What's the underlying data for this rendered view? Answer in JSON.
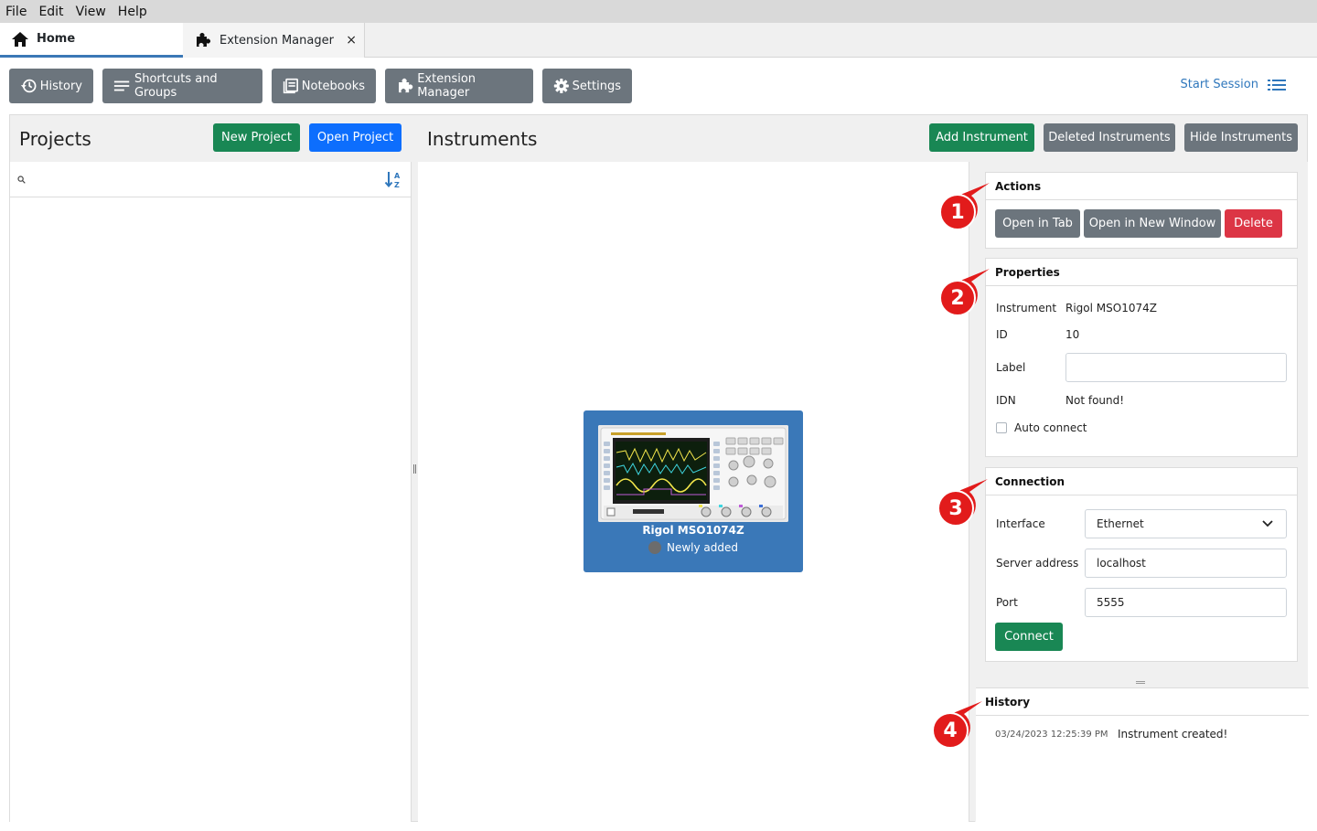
{
  "menu": [
    "File",
    "Edit",
    "View",
    "Help"
  ],
  "tabs": [
    {
      "label": "Home",
      "active": true
    },
    {
      "label": "Extension Manager",
      "closable": true,
      "close_glyph": "×"
    }
  ],
  "toolbar": {
    "buttons": [
      "History",
      "Shortcuts and Groups",
      "Notebooks",
      "Extension Manager",
      "Settings"
    ],
    "start_session": "Start Session"
  },
  "projects": {
    "title": "Projects",
    "new_project": "New Project",
    "open_project": "Open Project",
    "search_placeholder": ""
  },
  "instruments": {
    "title": "Instruments",
    "add_instrument": "Add Instrument",
    "deleted_instruments": "Deleted Instruments",
    "hide_instruments": "Hide Instruments",
    "card": {
      "name": "Rigol MSO1074Z",
      "status": "Newly added"
    }
  },
  "actions": {
    "title": "Actions",
    "open_in_tab": "Open in Tab",
    "open_in_new_window": "Open in New Window",
    "delete": "Delete"
  },
  "properties": {
    "title": "Properties",
    "instrument_label": "Instrument",
    "instrument_value": "Rigol MSO1074Z",
    "id_label": "ID",
    "id_value": "10",
    "label_label": "Label",
    "label_value": "",
    "idn_label": "IDN",
    "idn_value": "Not found!",
    "auto_connect": "Auto connect",
    "auto_connect_checked": false
  },
  "connection": {
    "title": "Connection",
    "interface_label": "Interface",
    "interface_value": "Ethernet",
    "server_label": "Server address",
    "server_value": "localhost",
    "port_label": "Port",
    "port_value": "5555",
    "connect": "Connect"
  },
  "history": {
    "title": "History",
    "entries": [
      {
        "time": "03/24/2023 12:25:39 PM",
        "text": "Instrument created!"
      }
    ]
  },
  "markers": [
    "1",
    "2",
    "3",
    "4"
  ],
  "colors": {
    "green": "#198754",
    "blue": "#0d6efd",
    "gray": "#6c757d",
    "red": "#dc3545",
    "card": "#3a78b8",
    "marker": "#e21b1b"
  }
}
